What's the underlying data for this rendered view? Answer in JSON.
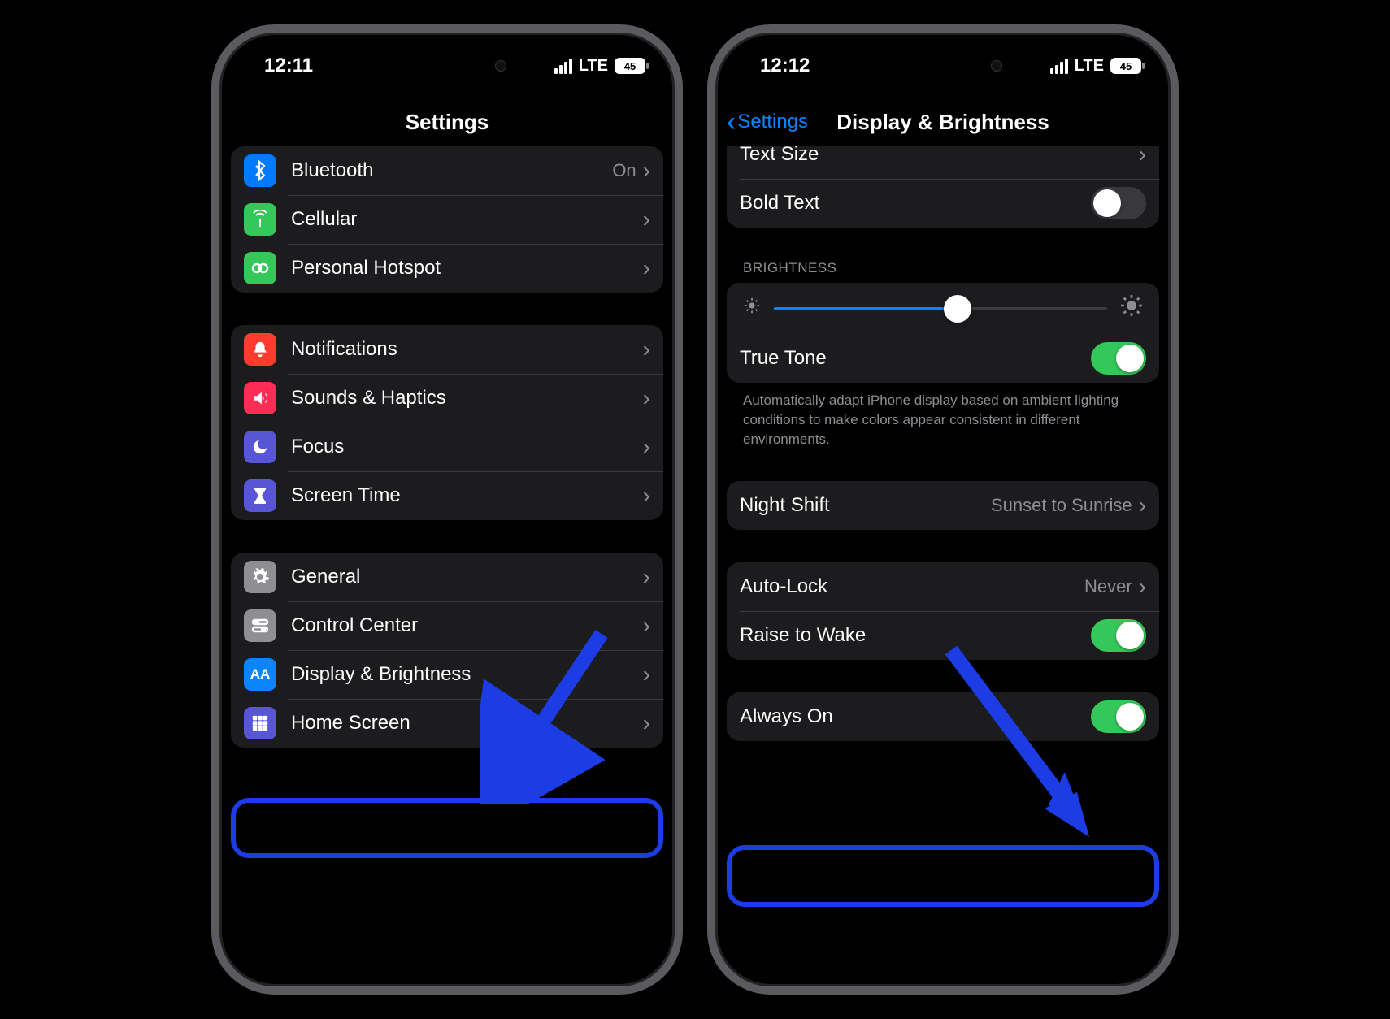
{
  "phone1": {
    "status": {
      "time": "12:11",
      "network": "LTE",
      "battery": "45"
    },
    "nav": {
      "title": "Settings"
    },
    "group1": [
      {
        "id": "bluetooth",
        "label": "Bluetooth",
        "value": "On",
        "iconClass": "ic-bt",
        "iconGlyph": "bt"
      },
      {
        "id": "cellular",
        "label": "Cellular",
        "iconClass": "ic-cell",
        "iconGlyph": "antenna"
      },
      {
        "id": "hotspot",
        "label": "Personal Hotspot",
        "iconClass": "ic-hs",
        "iconGlyph": "link"
      }
    ],
    "group2": [
      {
        "id": "notifications",
        "label": "Notifications",
        "iconClass": "ic-notif",
        "iconGlyph": "bell"
      },
      {
        "id": "sounds",
        "label": "Sounds & Haptics",
        "iconClass": "ic-sound",
        "iconGlyph": "speaker"
      },
      {
        "id": "focus",
        "label": "Focus",
        "iconClass": "ic-focus",
        "iconGlyph": "moon"
      },
      {
        "id": "screentime",
        "label": "Screen Time",
        "iconClass": "ic-st",
        "iconGlyph": "hourglass"
      }
    ],
    "group3": [
      {
        "id": "general",
        "label": "General",
        "iconClass": "ic-gen",
        "iconGlyph": "gear"
      },
      {
        "id": "controlcenter",
        "label": "Control Center",
        "iconClass": "ic-cc",
        "iconGlyph": "switches"
      },
      {
        "id": "display",
        "label": "Display & Brightness",
        "iconClass": "ic-db",
        "iconGlyph": "AA",
        "highlight": true
      },
      {
        "id": "homescreen",
        "label": "Home Screen",
        "iconClass": "ic-hsrn",
        "iconGlyph": "grid"
      }
    ]
  },
  "phone2": {
    "status": {
      "time": "12:12",
      "network": "LTE",
      "battery": "45"
    },
    "nav": {
      "back": "Settings",
      "title": "Display & Brightness"
    },
    "topRows": {
      "textSize": "Text Size",
      "boldText": "Bold Text"
    },
    "brightness": {
      "header": "BRIGHTNESS",
      "sliderPercent": 55,
      "trueTone": "True Tone",
      "note": "Automatically adapt iPhone display based on ambient lighting conditions to make colors appear consistent in different environments."
    },
    "nightShift": {
      "label": "Night Shift",
      "value": "Sunset to Sunrise"
    },
    "autoLock": {
      "label": "Auto-Lock",
      "value": "Never"
    },
    "raiseToWake": "Raise to Wake",
    "alwaysOn": "Always On"
  }
}
